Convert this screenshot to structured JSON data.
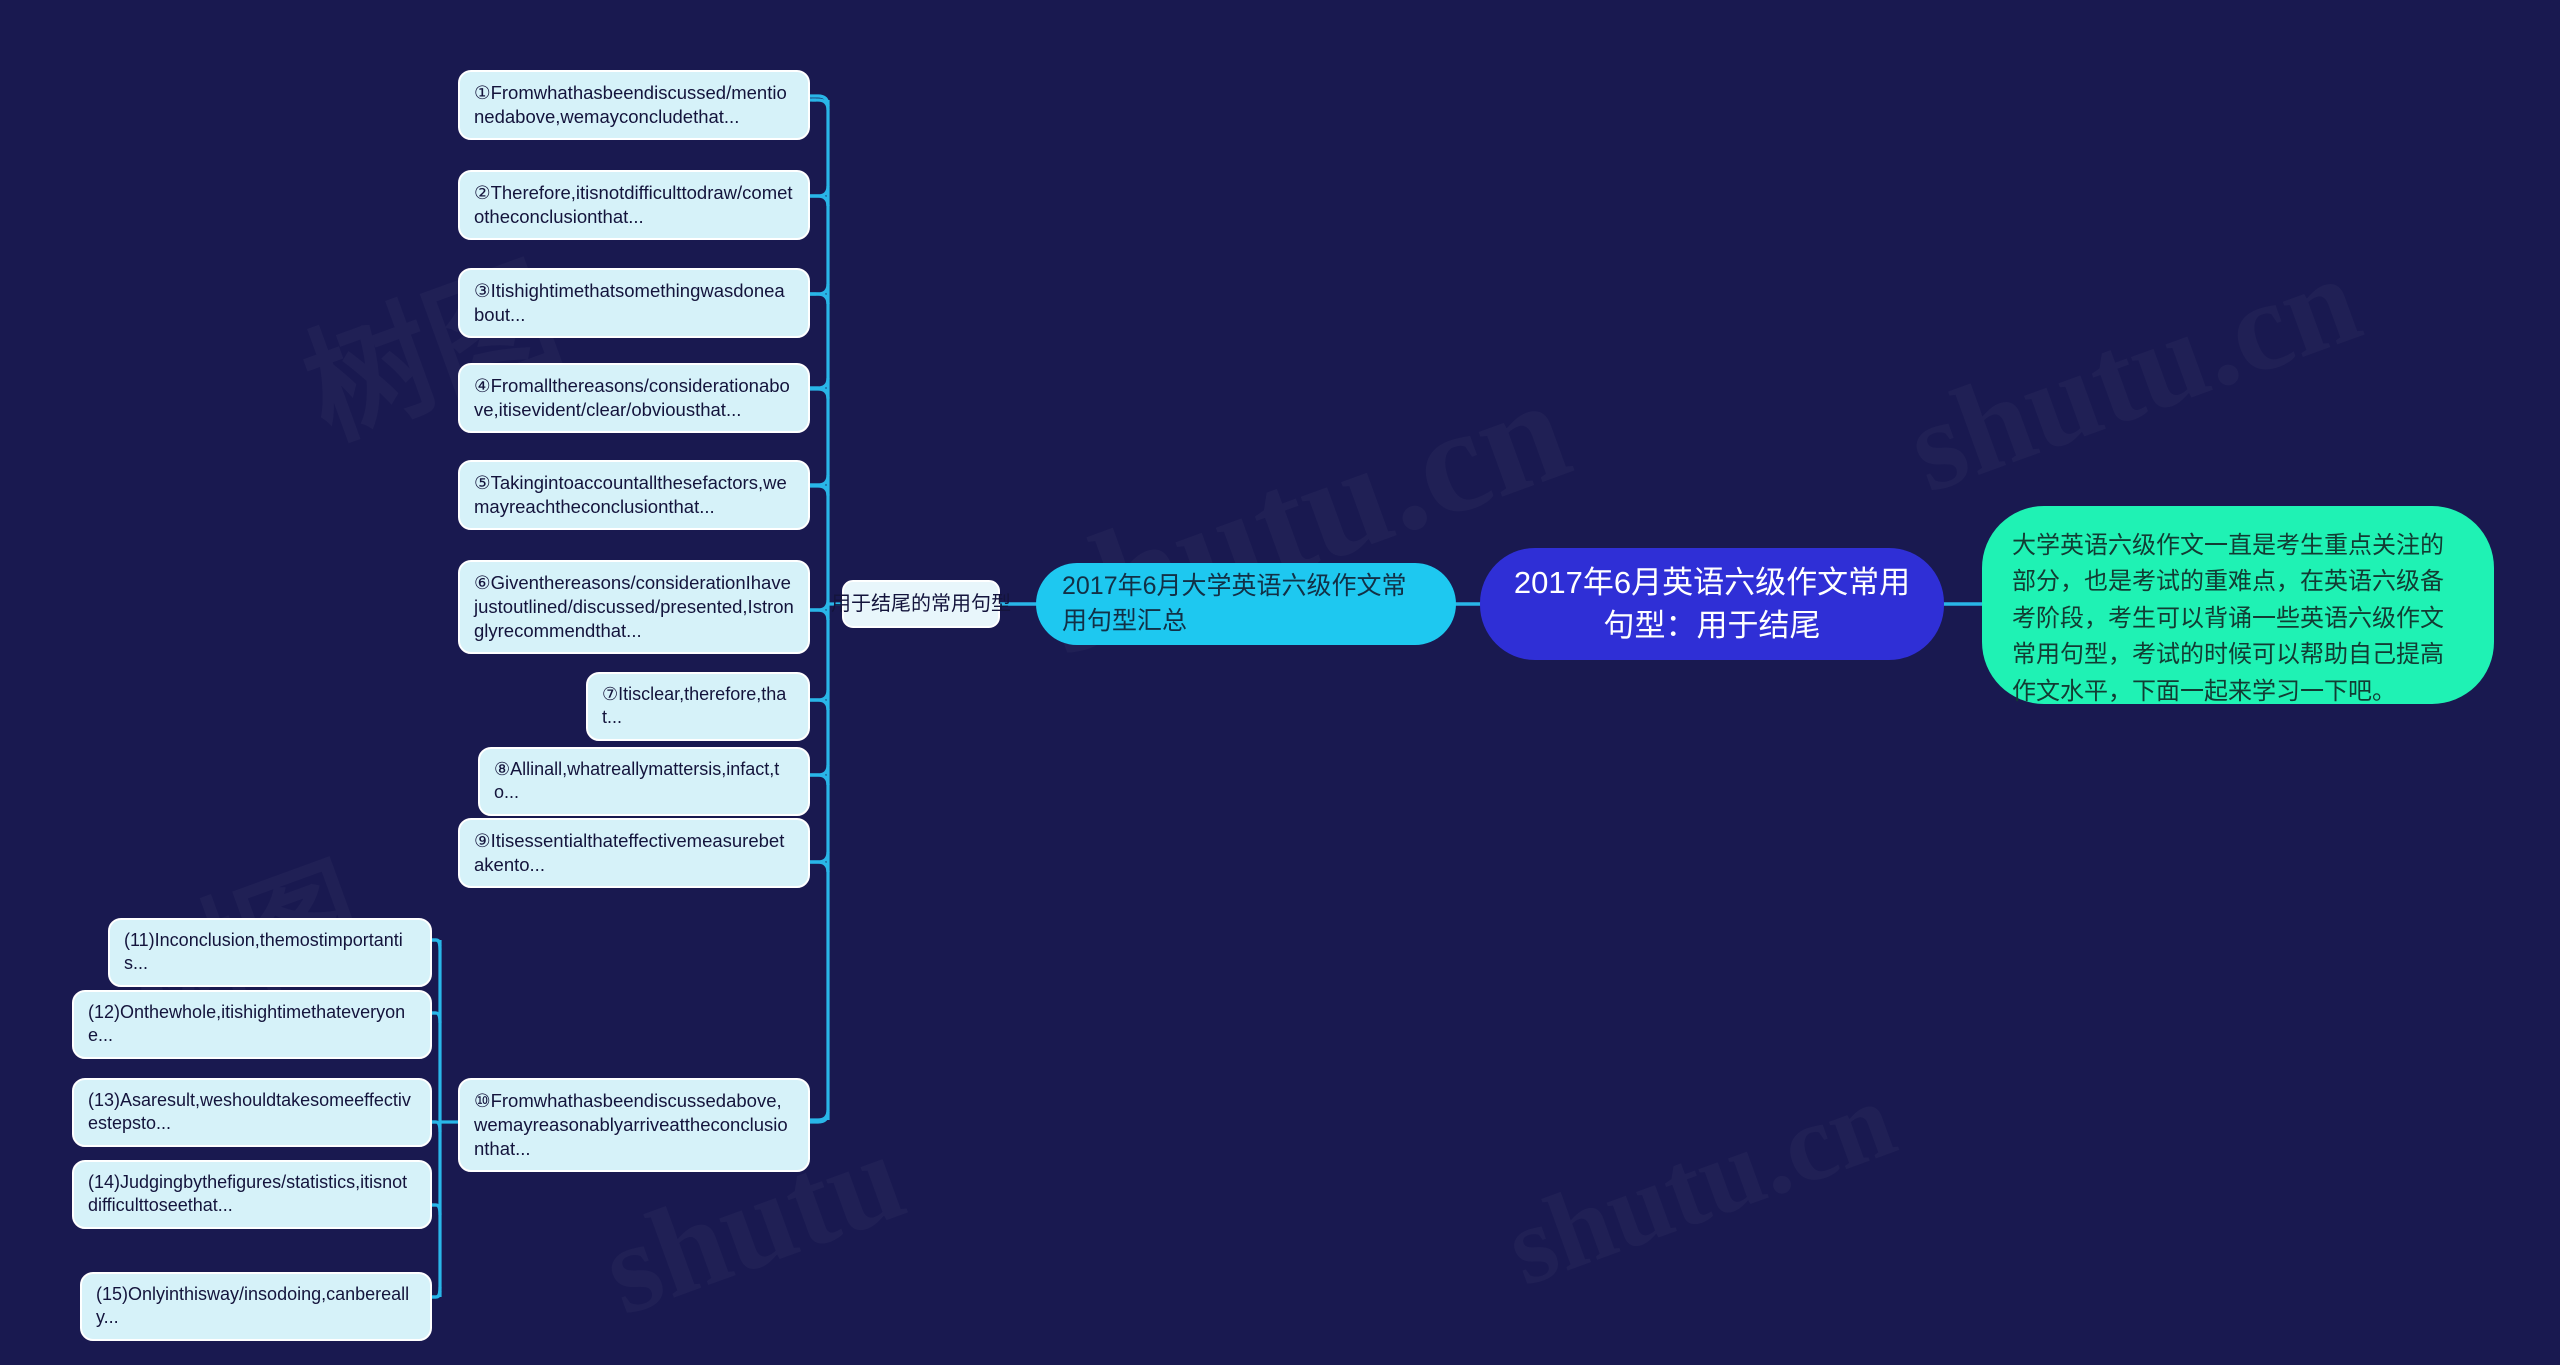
{
  "background_color": "#191950",
  "colors": {
    "root_node": "#2f2fd6",
    "summary_node": "#1ec8f0",
    "description_node": "#1ff2b4",
    "leaf_node": "#d6f2f9",
    "connector": "#29b6e8"
  },
  "root": {
    "title": "2017年6月英语六级作文常用句型：用于结尾"
  },
  "summary": {
    "title": "2017年6月大学英语六级作文常用句型汇总"
  },
  "description": {
    "text": "大学英语六级作文一直是考生重点关注的部分，也是考试的重难点，在英语六级备考阶段，考生可以背诵一些英语六级作文常用句型，考试的时候可以帮助自己提高作文水平，下面一起来学习一下吧。"
  },
  "category": {
    "label": "用于结尾的常用句型"
  },
  "watermarks": {
    "a": "树图",
    "b": "shutu.cn",
    "c": "shutu.cn",
    "d": "shutu",
    "e": "shutu.cn",
    "f": "树图"
  },
  "sentences": [
    {
      "id": 1,
      "marker": "①",
      "text": "Fromwhathasbeendiscussed/mentionedabove,wemayconcludethat..."
    },
    {
      "id": 2,
      "marker": "②",
      "text": "Therefore,itisnotdifficulttodraw/cometotheconclusionthat..."
    },
    {
      "id": 3,
      "marker": "③",
      "text": "Itishightimethatsomethingwasdoneabout..."
    },
    {
      "id": 4,
      "marker": "④",
      "text": "Fromallthereasons/considerationabove,itisevident/clear/obviousthat..."
    },
    {
      "id": 5,
      "marker": "⑤",
      "text": "Takingintoaccountallthesefactors,wemayreachtheconclusionthat..."
    },
    {
      "id": 6,
      "marker": "⑥",
      "text": "Giventhereasons/considerationIhavejustoutlined/discussed/presented,Istronglyrecommendthat..."
    },
    {
      "id": 7,
      "marker": "⑦",
      "text": "Itisclear,therefore,that..."
    },
    {
      "id": 8,
      "marker": "⑧",
      "text": "Allinall,whatreallymattersis,infact,to..."
    },
    {
      "id": 9,
      "marker": "⑨",
      "text": "Itisessentialthateffectivemeasurebetakento..."
    },
    {
      "id": 10,
      "marker": "⑩",
      "text": "Fromwhathasbeendiscussedabove,wemayreasonablyarriveattheconclusionthat..."
    }
  ],
  "sub_sentences": [
    {
      "id": 11,
      "marker": "(11)",
      "text": "Inconclusion,themostimportantis..."
    },
    {
      "id": 12,
      "marker": "(12)",
      "text": "Onthewhole,itishightimethateveryone..."
    },
    {
      "id": 13,
      "marker": "(13)",
      "text": "Asaresult,weshouldtakesomeeffectivestepsto..."
    },
    {
      "id": 14,
      "marker": "(14)",
      "text": "Judgingbythefigures/statistics,itisnotdifficulttoseethat..."
    },
    {
      "id": 15,
      "marker": "(15)",
      "text": "Onlyinthisway/insodoing,canbereally..."
    }
  ]
}
